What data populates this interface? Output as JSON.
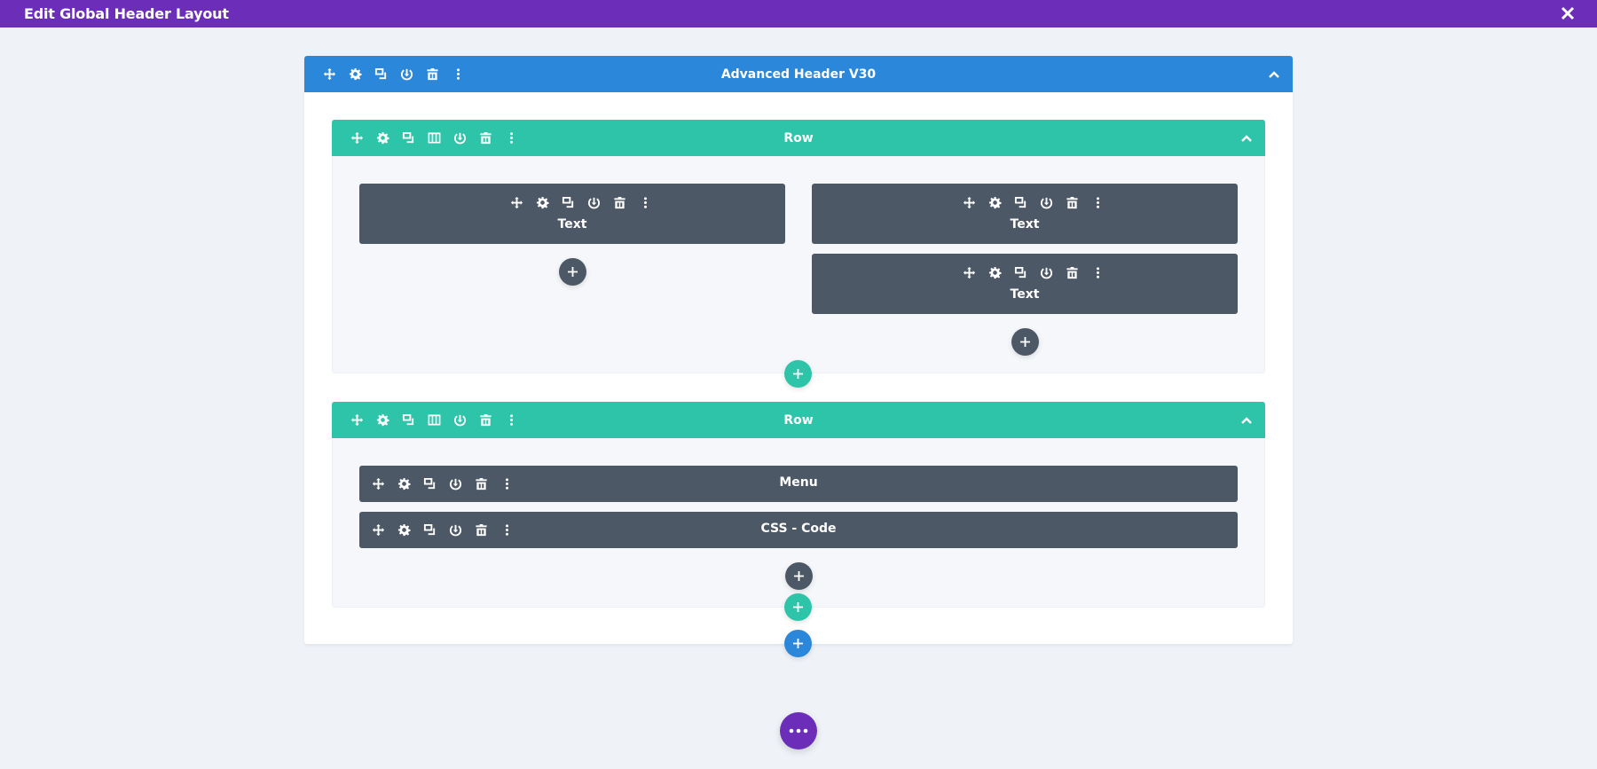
{
  "window": {
    "title": "Edit Global Header Layout",
    "close_icon": "close-icon"
  },
  "colors": {
    "topbar": "#6c2eb9",
    "section": "#2b87da",
    "row": "#2ec4a9",
    "module": "#4c5866",
    "background": "#eff3f8"
  },
  "section": {
    "label": "Advanced Header V30",
    "toolbar_icons": [
      "move-icon",
      "settings-icon",
      "duplicate-icon",
      "save-to-library-icon",
      "delete-icon",
      "more-options-icon"
    ],
    "collapse_icon": "chevron-up-icon"
  },
  "rows": [
    {
      "label": "Row",
      "toolbar_icons": [
        "move-icon",
        "settings-icon",
        "duplicate-icon",
        "columns-icon",
        "save-to-library-icon",
        "delete-icon",
        "more-options-icon"
      ],
      "columns": [
        {
          "modules": [
            {
              "label": "Text"
            }
          ]
        },
        {
          "modules": [
            {
              "label": "Text"
            },
            {
              "label": "Text"
            }
          ]
        }
      ]
    },
    {
      "label": "Row",
      "toolbar_icons": [
        "move-icon",
        "settings-icon",
        "duplicate-icon",
        "columns-icon",
        "save-to-library-icon",
        "delete-icon",
        "more-options-icon"
      ],
      "columns": [
        {
          "modules": [
            {
              "label": "Menu"
            },
            {
              "label": "CSS - Code"
            }
          ]
        }
      ]
    }
  ],
  "module_toolbar_icons": [
    "move-icon",
    "settings-icon",
    "duplicate-icon",
    "save-to-library-icon",
    "delete-icon",
    "more-options-icon"
  ],
  "buttons": {
    "add_module": "plus-icon",
    "add_row": "plus-icon",
    "add_section": "plus-icon",
    "page_settings": "more-horizontal-icon"
  }
}
